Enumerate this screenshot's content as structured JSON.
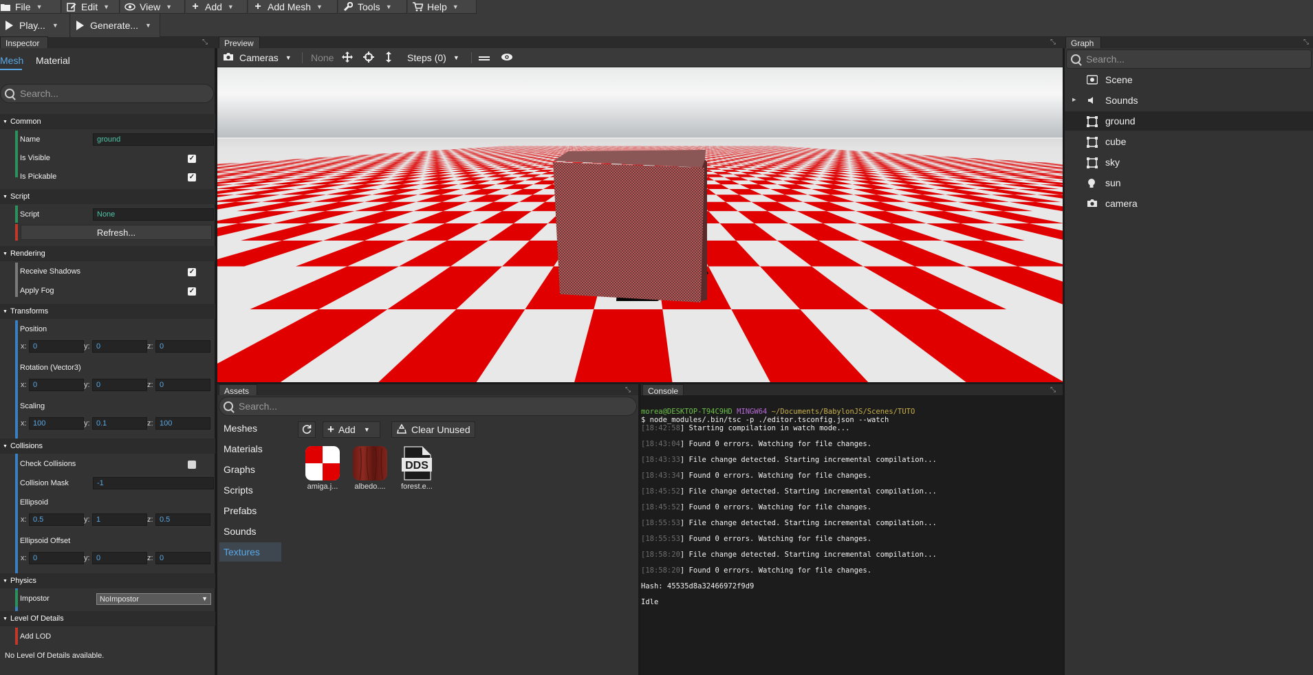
{
  "menubar": {
    "items": [
      {
        "label": "File",
        "icon": "folder-icon"
      },
      {
        "label": "Edit",
        "icon": "edit-icon"
      },
      {
        "label": "View",
        "icon": "eye-icon"
      },
      {
        "label": "Add",
        "icon": "plus-icon"
      },
      {
        "label": "Add Mesh",
        "icon": "plus-icon"
      },
      {
        "label": "Tools",
        "icon": "wrench-icon"
      },
      {
        "label": "Help",
        "icon": "cart-icon"
      }
    ]
  },
  "toolbar": {
    "play_label": "Play...",
    "generate_label": "Generate..."
  },
  "inspector": {
    "title": "Inspector",
    "tabs": [
      "Mesh",
      "Material"
    ],
    "search_placeholder": "Search...",
    "sections": {
      "common": "Common",
      "script": "Script",
      "rendering": "Rendering",
      "transforms": "Transforms",
      "collisions": "Collisions",
      "physics": "Physics",
      "lod": "Level Of Details"
    },
    "labels": {
      "name": "Name",
      "is_visible": "Is Visible",
      "is_pickable": "Is Pickable",
      "script": "Script",
      "refresh": "Refresh...",
      "receive_shadows": "Receive Shadows",
      "apply_fog": "Apply Fog",
      "position": "Position",
      "rotation": "Rotation (Vector3)",
      "scaling": "Scaling",
      "check_collisions": "Check Collisions",
      "collision_mask": "Collision Mask",
      "ellipsoid": "Ellipsoid",
      "ellipsoid_offset": "Ellipsoid Offset",
      "impostor": "Impostor",
      "add_lod": "Add LOD",
      "no_lod": "No Level Of Details available."
    },
    "values": {
      "name": "ground",
      "script": "None",
      "is_visible": true,
      "is_pickable": true,
      "receive_shadows": true,
      "apply_fog": true,
      "check_collisions": false,
      "position": {
        "x": "0",
        "y": "0",
        "z": "0"
      },
      "rotation": {
        "x": "0",
        "y": "0",
        "z": "0"
      },
      "scaling": {
        "x": "100",
        "y": "0.1",
        "z": "100"
      },
      "collision_mask": "-1",
      "ellipsoid": {
        "x": "0.5",
        "y": "1",
        "z": "0.5"
      },
      "ellipsoid_offset": {
        "x": "0",
        "y": "0",
        "z": "0"
      },
      "impostor": "NoImpostor"
    },
    "axis": {
      "x": "x:",
      "y": "y:",
      "z": "z:"
    }
  },
  "preview": {
    "title": "Preview",
    "cameras_label": "Cameras",
    "none_label": "None",
    "steps_label": "Steps (0)"
  },
  "assets": {
    "title": "Assets",
    "search_placeholder": "Search...",
    "add_label": "Add",
    "clear_label": "Clear Unused",
    "categories": [
      "Meshes",
      "Materials",
      "Graphs",
      "Scripts",
      "Prefabs",
      "Sounds",
      "Textures"
    ],
    "active_category": "Textures",
    "items": [
      {
        "label": "amiga.j..."
      },
      {
        "label": "albedo...."
      },
      {
        "label": "forest.e..."
      }
    ],
    "dds_text": "DDS"
  },
  "console": {
    "title": "Console",
    "prompt_user": "morea@DESKTOP-T94C9HD",
    "prompt_env": "MINGW64",
    "prompt_path": "~/Documents/BabylonJS/Scenes/TUTO",
    "command": "$ node_modules/.bin/tsc -p ./editor.tsconfig.json --watch",
    "lines": [
      {
        "ts": "[18:42:58",
        "msg": "] Starting compilation in watch mode..."
      },
      {
        "ts": "[18:43:04",
        "msg": "] Found 0 errors. Watching for file changes."
      },
      {
        "ts": "[18:43:33",
        "msg": "] File change detected. Starting incremental compilation..."
      },
      {
        "ts": "[18:43:34",
        "msg": "] Found 0 errors. Watching for file changes."
      },
      {
        "ts": "[18:45:52",
        "msg": "] File change detected. Starting incremental compilation..."
      },
      {
        "ts": "[18:45:52",
        "msg": "] Found 0 errors. Watching for file changes."
      },
      {
        "ts": "[18:55:53",
        "msg": "] File change detected. Starting incremental compilation..."
      },
      {
        "ts": "[18:55:53",
        "msg": "] Found 0 errors. Watching for file changes."
      },
      {
        "ts": "[18:58:20",
        "msg": "] File change detected. Starting incremental compilation..."
      },
      {
        "ts": "[18:58:20",
        "msg": "] Found 0 errors. Watching for file changes."
      }
    ],
    "hash_line": "Hash: 45535d8a32466972f9d9",
    "last_line": "Idle"
  },
  "graph": {
    "title": "Graph",
    "search_placeholder": "Search...",
    "items": [
      {
        "label": "Scene",
        "icon": "scene-icon"
      },
      {
        "label": "Sounds",
        "icon": "speaker-icon"
      },
      {
        "label": "ground",
        "icon": "mesh-icon"
      },
      {
        "label": "cube",
        "icon": "mesh-icon"
      },
      {
        "label": "sky",
        "icon": "mesh-icon"
      },
      {
        "label": "sun",
        "icon": "lightbulb-icon"
      },
      {
        "label": "camera",
        "icon": "camera-icon"
      }
    ],
    "selected": "ground"
  },
  "colors": {
    "accent": "#5aa9e6",
    "green_value": "#4fc4a8",
    "checker_red": "#e00000",
    "checker_white": "#e8e8e8"
  }
}
